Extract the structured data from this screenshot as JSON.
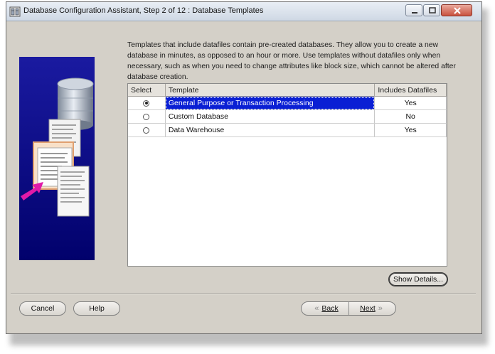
{
  "window": {
    "title": "Database Configuration Assistant, Step 2 of 12 : Database Templates"
  },
  "description": "Templates that include datafiles contain pre-created databases. They allow you to create a new database in minutes, as opposed to an hour or more. Use templates without datafiles only when necessary, such as when you need to change attributes like block size, which cannot be altered after database creation.",
  "table": {
    "headers": [
      "Select",
      "Template",
      "Includes Datafiles"
    ],
    "rows": [
      {
        "template": "General Purpose or Transaction Processing",
        "datafiles": "Yes",
        "selected": true
      },
      {
        "template": "Custom Database",
        "datafiles": "No",
        "selected": false
      },
      {
        "template": "Data Warehouse",
        "datafiles": "Yes",
        "selected": false
      }
    ]
  },
  "buttons": {
    "show_details": "Show Details...",
    "cancel": "Cancel",
    "help": "Help",
    "back": "Back",
    "next": "Next"
  },
  "colors": {
    "selection": "#0a1fd4",
    "wizard_image_bg": "#01016c",
    "dialog_bg": "#d4d0c8"
  },
  "icons": {
    "app": "database-icon",
    "illustration": "database-templates-illustration"
  }
}
